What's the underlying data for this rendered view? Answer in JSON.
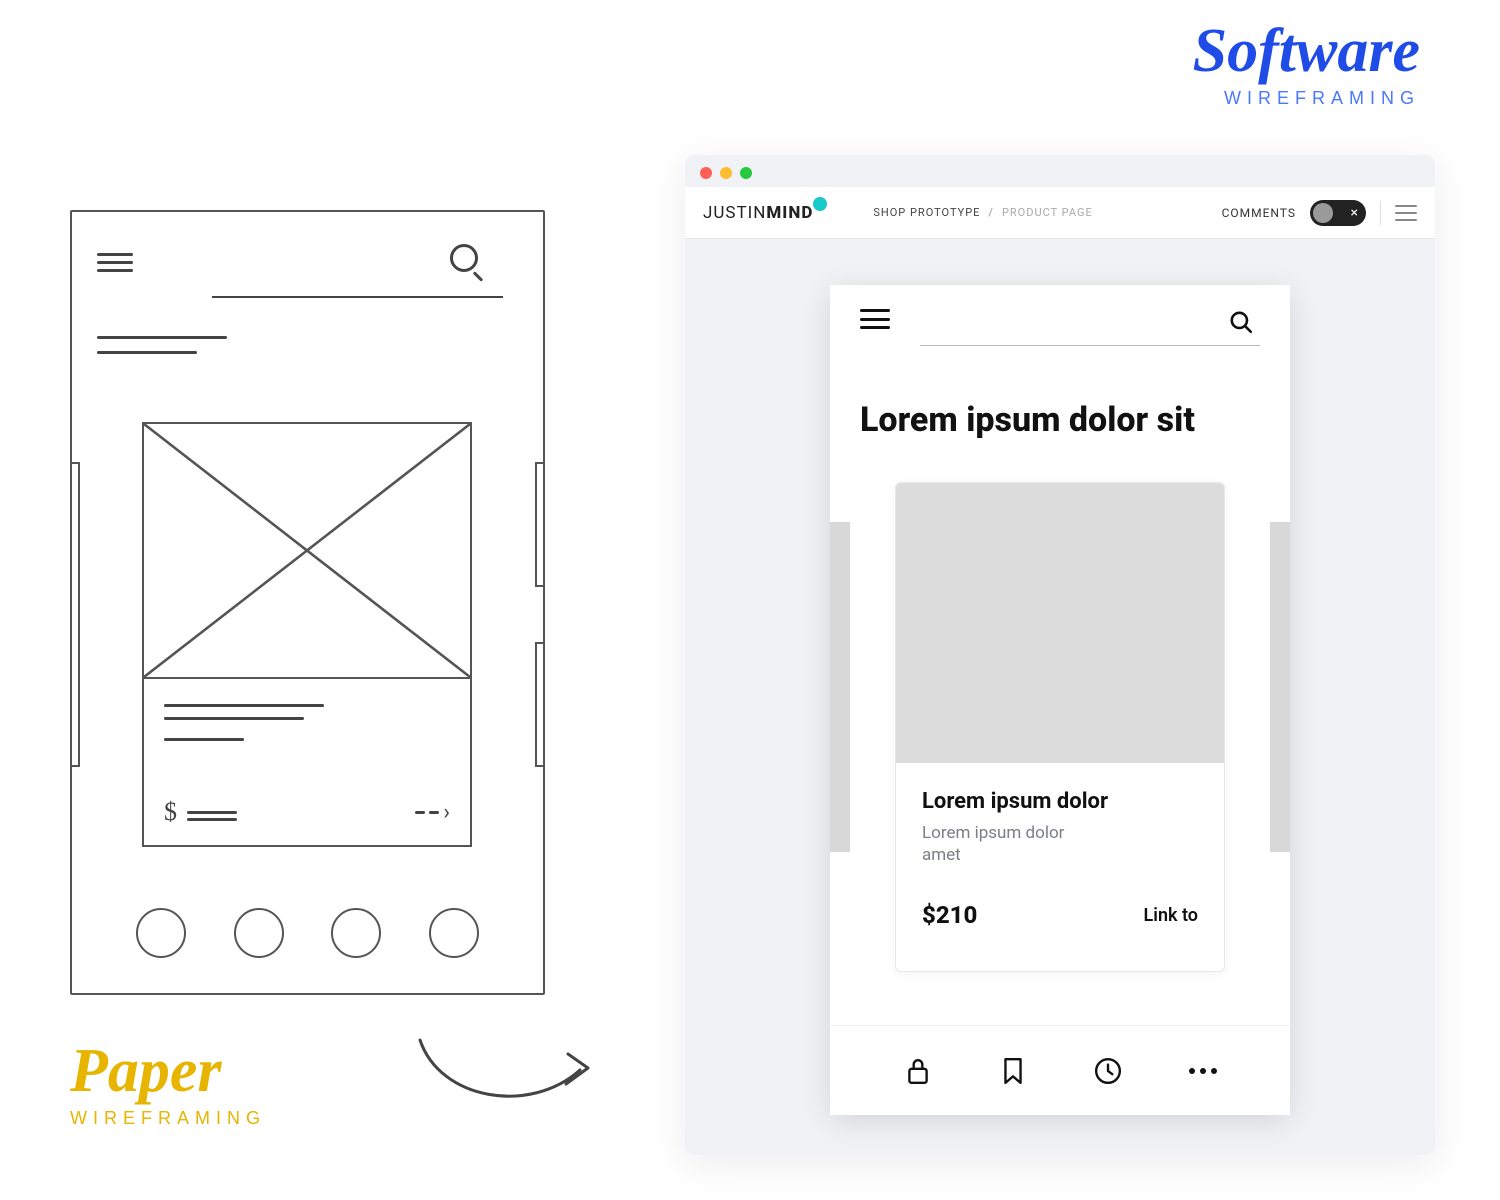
{
  "labels": {
    "software": {
      "title": "Software",
      "subtitle": "WIREFRAMING"
    },
    "paper": {
      "title": "Paper",
      "subtitle": "WIREFRAMING"
    }
  },
  "toolbar": {
    "brand_prefix": "JUSTIN",
    "brand_bold": "MIND",
    "breadcrumb": {
      "part1": "SHOP PROTOTYPE",
      "sep": "/",
      "part2": "PRODUCT PAGE"
    },
    "comments_label": "COMMENTS",
    "toggle_close": "×"
  },
  "phone": {
    "title": "Lorem ipsum dolor sit",
    "card": {
      "heading": "Lorem ipsum dolor",
      "subtitle": "Lorem ipsum dolor amet",
      "price": "$210",
      "link_text": "Link to"
    },
    "nav_icons": [
      "lock-icon",
      "bookmark-icon",
      "clock-icon",
      "more-icon"
    ]
  },
  "sketch": {
    "dollar": "$"
  }
}
